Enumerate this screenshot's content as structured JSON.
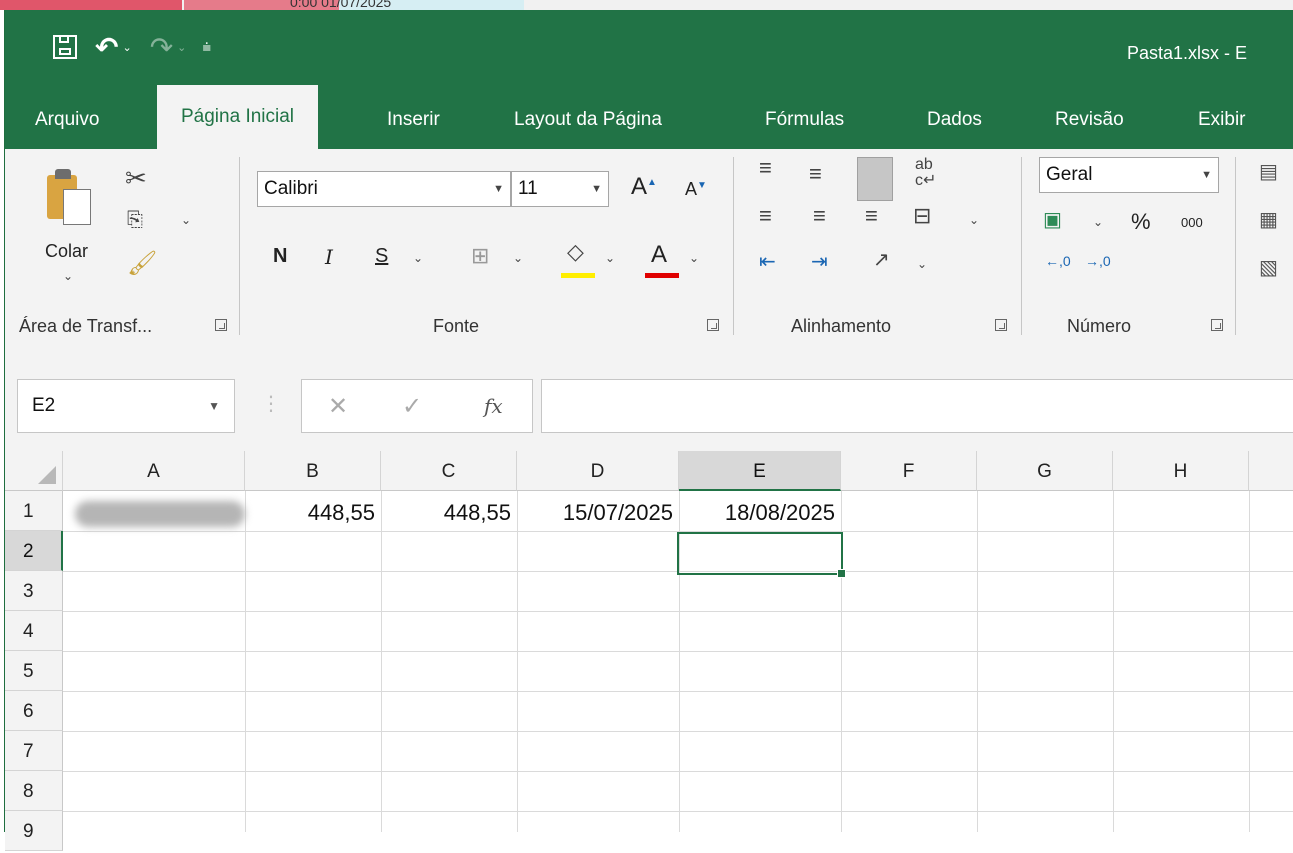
{
  "background": {
    "text": "0:00 01/07/2025"
  },
  "titlebar": {
    "doc_title": "Pasta1.xlsx  -  E",
    "accent_color": "#217346"
  },
  "tabs": [
    {
      "label": "Arquivo"
    },
    {
      "label": "Página Inicial"
    },
    {
      "label": "Inserir"
    },
    {
      "label": "Layout da Página"
    },
    {
      "label": "Fórmulas"
    },
    {
      "label": "Dados"
    },
    {
      "label": "Revisão"
    },
    {
      "label": "Exibir"
    }
  ],
  "ribbon": {
    "clipboard": {
      "paste_label": "Colar",
      "group_label": "Área de Transf..."
    },
    "font": {
      "font_name": "Calibri",
      "font_size": "11",
      "bold": "N",
      "italic": "I",
      "underline": "S",
      "grow": "A",
      "shrink": "A",
      "font_color": "A",
      "group_label": "Fonte"
    },
    "alignment": {
      "group_label": "Alinhamento"
    },
    "number": {
      "format": "Geral",
      "percent": "%",
      "thousands": "000",
      "group_label": "Número"
    }
  },
  "formula_bar": {
    "name_box": "E2",
    "fx": "fx",
    "content": ""
  },
  "sheet": {
    "columns": [
      "A",
      "B",
      "C",
      "D",
      "E",
      "F",
      "G",
      "H"
    ],
    "rows": [
      "1",
      "2",
      "3",
      "4",
      "5",
      "6",
      "7",
      "8",
      "9"
    ],
    "selected_column": "E",
    "selected_row": "2",
    "row1": {
      "B": "448,55",
      "C": "448,55",
      "D": "15/07/2025",
      "E": "18/08/2025"
    }
  }
}
